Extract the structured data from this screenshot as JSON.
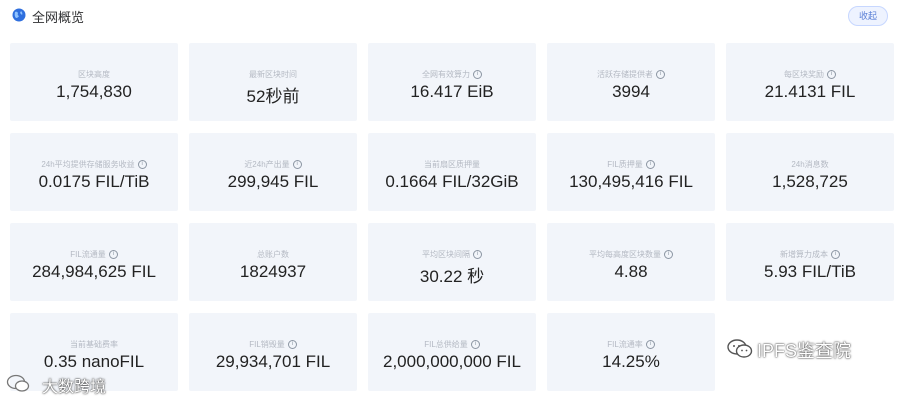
{
  "header": {
    "title": "全网概览",
    "collapse_label": "收起"
  },
  "cards": [
    {
      "label": "区块高度",
      "info": false,
      "value": "1,754,830"
    },
    {
      "label": "最新区块时间",
      "info": false,
      "value": "52秒前"
    },
    {
      "label": "全网有效算力",
      "info": true,
      "value": "16.417 EiB"
    },
    {
      "label": "活跃存储提供者",
      "info": true,
      "value": "3994"
    },
    {
      "label": "每区块奖励",
      "info": true,
      "value": "21.4131 FIL"
    },
    {
      "label": "24h平均提供存储服务收益",
      "info": true,
      "value": "0.0175 FIL/TiB"
    },
    {
      "label": "近24h产出量",
      "info": true,
      "value": "299,945 FIL"
    },
    {
      "label": "当前扇区质押量",
      "info": false,
      "value": "0.1664 FIL/32GiB"
    },
    {
      "label": "FIL质押量",
      "info": true,
      "value": "130,495,416 FIL"
    },
    {
      "label": "24h消息数",
      "info": false,
      "value": "1,528,725"
    },
    {
      "label": "FIL流通量",
      "info": true,
      "value": "284,984,625 FIL"
    },
    {
      "label": "总账户数",
      "info": false,
      "value": "1824937"
    },
    {
      "label": "平均区块间隔",
      "info": true,
      "value": "30.22 秒"
    },
    {
      "label": "平均每高度区块数量",
      "info": true,
      "value": "4.88"
    },
    {
      "label": "新增算力成本",
      "info": true,
      "value": "5.93 FIL/TiB"
    },
    {
      "label": "当前基础费率",
      "info": false,
      "value": "0.35 nanoFIL"
    },
    {
      "label": "FIL销毁量",
      "info": true,
      "value": "29,934,701 FIL"
    },
    {
      "label": "FIL总供给量",
      "info": true,
      "value": "2,000,000,000 FIL"
    },
    {
      "label": "FIL流通率",
      "info": true,
      "value": "14.25%"
    }
  ],
  "watermarks": {
    "right": "IPFS鉴查院",
    "left": "大数跨境"
  },
  "colors": {
    "card_bg": "#f2f5fa",
    "accent": "#5a7fd6",
    "label": "#b4b9c3",
    "value": "#222222"
  }
}
